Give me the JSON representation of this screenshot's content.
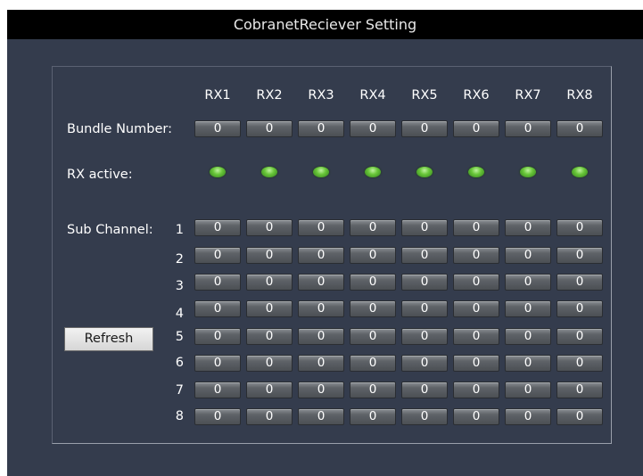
{
  "window": {
    "title": "CobranetReciever Setting"
  },
  "columns": [
    "RX1",
    "RX2",
    "RX3",
    "RX4",
    "RX5",
    "RX6",
    "RX7",
    "RX8"
  ],
  "bundle": {
    "label": "Bundle Number:",
    "values": [
      "0",
      "0",
      "0",
      "0",
      "0",
      "0",
      "0",
      "0"
    ]
  },
  "rx_active": {
    "label": "RX active:",
    "states": [
      true,
      true,
      true,
      true,
      true,
      true,
      true,
      true
    ],
    "led_color": "#6ac73a"
  },
  "sub_channel": {
    "label": "Sub Channel:",
    "rows": [
      {
        "number": "1",
        "values": [
          "0",
          "0",
          "0",
          "0",
          "0",
          "0",
          "0",
          "0"
        ]
      },
      {
        "number": "2",
        "values": [
          "0",
          "0",
          "0",
          "0",
          "0",
          "0",
          "0",
          "0"
        ]
      },
      {
        "number": "3",
        "values": [
          "0",
          "0",
          "0",
          "0",
          "0",
          "0",
          "0",
          "0"
        ]
      },
      {
        "number": "4",
        "values": [
          "0",
          "0",
          "0",
          "0",
          "0",
          "0",
          "0",
          "0"
        ]
      },
      {
        "number": "5",
        "values": [
          "0",
          "0",
          "0",
          "0",
          "0",
          "0",
          "0",
          "0"
        ]
      },
      {
        "number": "6",
        "values": [
          "0",
          "0",
          "0",
          "0",
          "0",
          "0",
          "0",
          "0"
        ]
      },
      {
        "number": "7",
        "values": [
          "0",
          "0",
          "0",
          "0",
          "0",
          "0",
          "0",
          "0"
        ]
      },
      {
        "number": "8",
        "values": [
          "0",
          "0",
          "0",
          "0",
          "0",
          "0",
          "0",
          "0"
        ]
      }
    ]
  },
  "refresh_button": {
    "label": "Refresh"
  }
}
